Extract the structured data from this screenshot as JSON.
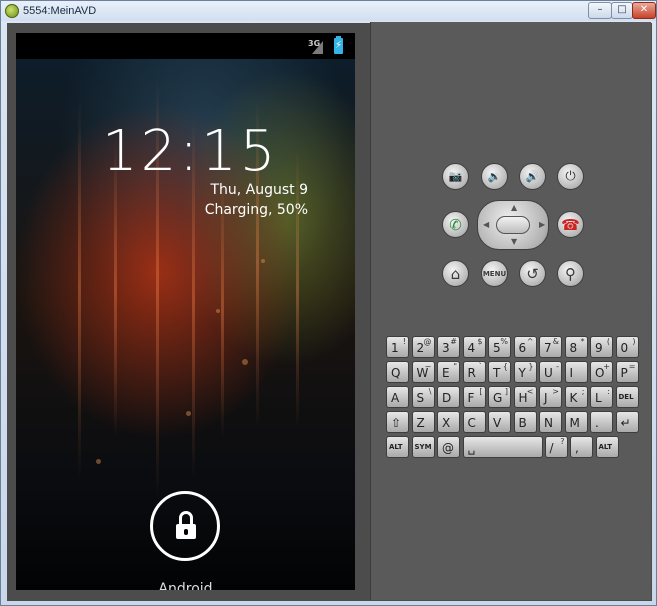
{
  "window": {
    "title": "5554:MeinAVD",
    "minimize": "–",
    "maximize": "□",
    "close": "✕"
  },
  "statusbar": {
    "network": "3G",
    "battery_icon": "charging-battery-icon"
  },
  "lockscreen": {
    "time": "12:15",
    "date": "Thu, August 9",
    "charging": "Charging, 50%",
    "carrier": "Android",
    "lock_icon": "lock-icon"
  },
  "hardware_buttons": {
    "camera": "📷",
    "volume_down": "🔉",
    "volume_up": "🔊",
    "power": "⏻",
    "call": "✆",
    "end_call": "☎",
    "home": "⌂",
    "menu": "MENU",
    "back": "↺",
    "search": "⚲"
  },
  "keyboard": {
    "rows": [
      [
        {
          "m": "1",
          "a": "!"
        },
        {
          "m": "2",
          "a": "@"
        },
        {
          "m": "3",
          "a": "#"
        },
        {
          "m": "4",
          "a": "$"
        },
        {
          "m": "5",
          "a": "%"
        },
        {
          "m": "6",
          "a": "^"
        },
        {
          "m": "7",
          "a": "&"
        },
        {
          "m": "8",
          "a": "*"
        },
        {
          "m": "9",
          "a": "("
        },
        {
          "m": "0",
          "a": ")"
        }
      ],
      [
        {
          "m": "Q",
          "a": ""
        },
        {
          "m": "W",
          "a": "~"
        },
        {
          "m": "E",
          "a": "\""
        },
        {
          "m": "R",
          "a": "`"
        },
        {
          "m": "T",
          "a": "{"
        },
        {
          "m": "Y",
          "a": "}"
        },
        {
          "m": "U",
          "a": "-"
        },
        {
          "m": "I",
          "a": ""
        },
        {
          "m": "O",
          "a": "+"
        },
        {
          "m": "P",
          "a": "="
        }
      ],
      [
        {
          "m": "A",
          "a": ""
        },
        {
          "m": "S",
          "a": "\\"
        },
        {
          "m": "D",
          "a": ""
        },
        {
          "m": "F",
          "a": "["
        },
        {
          "m": "G",
          "a": "]"
        },
        {
          "m": "H",
          "a": "<"
        },
        {
          "m": "J",
          "a": ">"
        },
        {
          "m": "K",
          "a": ";"
        },
        {
          "m": "L",
          "a": ":"
        },
        {
          "m": "DEL",
          "a": ""
        }
      ],
      [
        {
          "m": "⇧",
          "a": ""
        },
        {
          "m": "Z",
          "a": ""
        },
        {
          "m": "X",
          "a": ""
        },
        {
          "m": "C",
          "a": ""
        },
        {
          "m": "V",
          "a": ""
        },
        {
          "m": "B",
          "a": ""
        },
        {
          "m": "N",
          "a": ""
        },
        {
          "m": "M",
          "a": ""
        },
        {
          "m": ".",
          "a": ""
        },
        {
          "m": "↵",
          "a": ""
        }
      ],
      [
        {
          "m": "ALT",
          "a": ""
        },
        {
          "m": "SYM",
          "a": ""
        },
        {
          "m": "@",
          "a": ""
        },
        {
          "m": "␣",
          "a": ""
        },
        {
          "m": "/",
          "a": "?"
        },
        {
          "m": ",",
          "a": ""
        },
        {
          "m": "ALT",
          "a": ""
        }
      ]
    ]
  }
}
